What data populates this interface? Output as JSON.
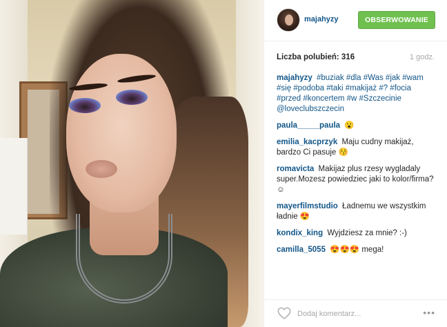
{
  "post": {
    "username": "majahyzy",
    "follow_label": "OBSERWOWANIE",
    "likes_text": "Liczba polubień: 316",
    "time_ago": "1 godz.",
    "caption": {
      "user": "majahyzy",
      "text": "#buziak #dla #Was #jak #wam #się #podoba #taki #makijaż #? #focia #przed #koncertem #w #Szczecinie @loveclubszczecin"
    },
    "comments": [
      {
        "user": "paula_____paula",
        "text": "😮"
      },
      {
        "user": "emilia_kacprzyk",
        "text": "Maju cudny makijaż, bardzo Ci pasuje 😚"
      },
      {
        "user": "romavicta",
        "text": "Makijaz plus rzesy wygladaly super.Mozesz powiedziec jaki to kolor/firma? ☺"
      },
      {
        "user": "mayerfilmstudio",
        "text": "Ładnemu we wszystkim ładnie 😍"
      },
      {
        "user": "kondix_king",
        "text": "Wyjdziesz za mnie? :-)"
      },
      {
        "user": "camilla_5055",
        "text": "😍😍😍 mega!"
      }
    ],
    "comment_placeholder": "Dodaj komentarz...",
    "more_label": "•••"
  },
  "colors": {
    "follow_green": "#70c050",
    "link_blue": "#125688",
    "muted_gray": "#a5a7aa"
  },
  "icons": {
    "like": "heart-outline-icon",
    "more": "ellipsis-icon"
  }
}
